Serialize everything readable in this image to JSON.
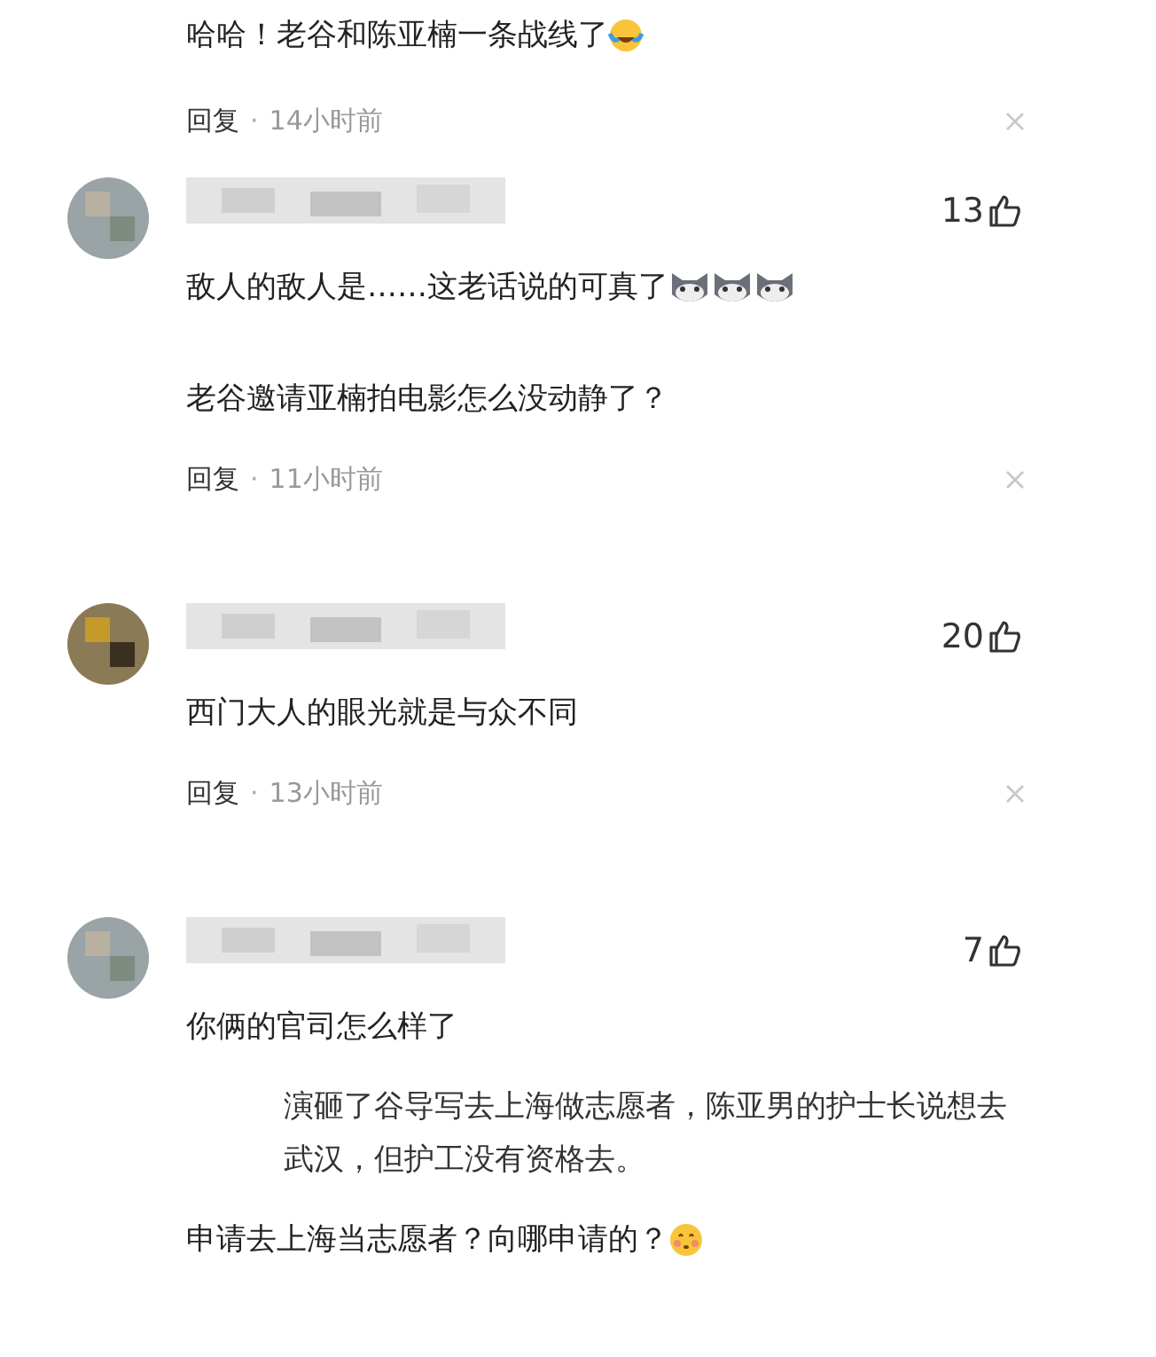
{
  "blocks": [
    {
      "kind": "reply",
      "text": "哈哈！老谷和陈亚楠一条战线了",
      "emojis": [
        {
          "kind": "tears"
        }
      ],
      "meta": {
        "reply": "回复",
        "dot": "·",
        "time": "14小时前"
      }
    },
    {
      "kind": "comment",
      "likes": "13",
      "text": "敌人的敌人是……这老话说的可真了",
      "emojis": [
        {
          "kind": "cat"
        },
        {
          "kind": "cat"
        },
        {
          "kind": "cat"
        }
      ]
    },
    {
      "kind": "reply",
      "text": "老谷邀请亚楠拍电影怎么没动静了？",
      "meta": {
        "reply": "回复",
        "dot": "·",
        "time": "11小时前"
      }
    },
    {
      "kind": "comment",
      "likes": "20",
      "text": "西门大人的眼光就是与众不同",
      "meta": {
        "reply": "回复",
        "dot": "·",
        "time": "13小时前"
      }
    },
    {
      "kind": "comment",
      "likes": "7",
      "text": "你俩的官司怎么样了",
      "quote": "演砸了谷导写去上海做志愿者，陈亚男的护士长说想去武汉，但护工没有资格去。",
      "followup": {
        "text": "申请去上海当志愿者？向哪申请的？",
        "emojis": [
          {
            "kind": "blush"
          }
        ]
      }
    }
  ]
}
